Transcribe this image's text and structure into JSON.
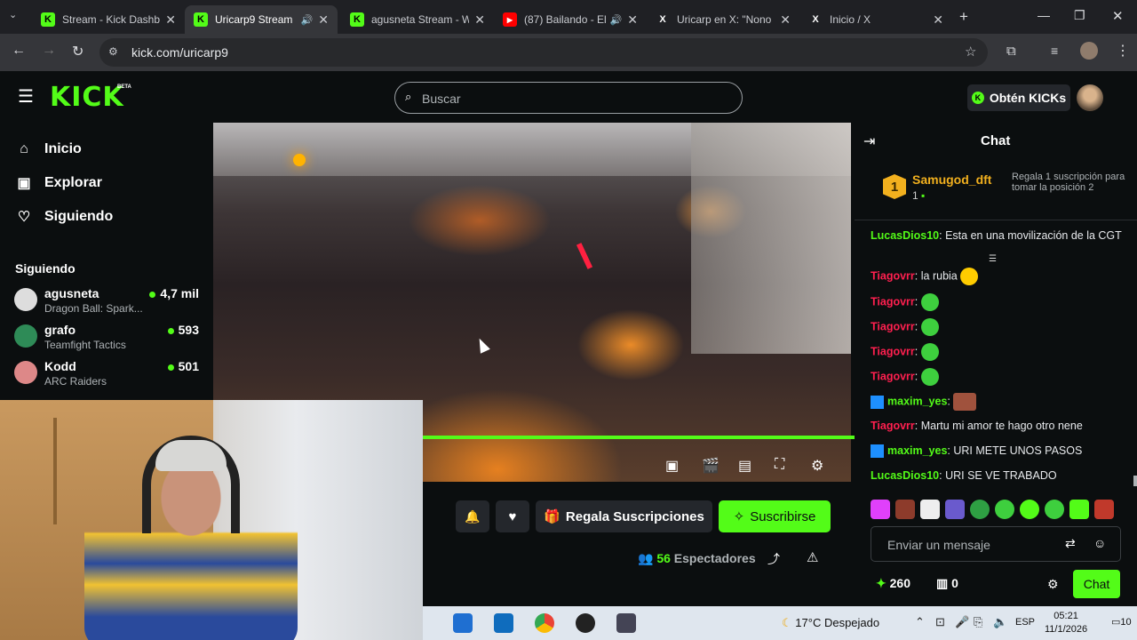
{
  "browser": {
    "tabs": [
      {
        "title": "Stream - Kick Dashbo",
        "favicon": "K"
      },
      {
        "title": "Uricarp9 Stream",
        "favicon": "K"
      },
      {
        "title": "agusneta Stream - W",
        "favicon": "K"
      },
      {
        "title": "(87) Bailando - El",
        "favicon": "YT"
      },
      {
        "title": "Uricarp en X: \"Nono l",
        "favicon": "X"
      },
      {
        "title": "Inicio / X",
        "favicon": "X"
      }
    ],
    "url": "kick.com/uricarp9"
  },
  "header": {
    "logo": "KICK",
    "logo_badge": "BETA",
    "search_placeholder": "Buscar",
    "get_kicks_label": "Obtén KICKs"
  },
  "sidebar": {
    "nav": [
      {
        "label": "Inicio",
        "icon": "home-icon"
      },
      {
        "label": "Explorar",
        "icon": "explore-icon"
      },
      {
        "label": "Siguiendo",
        "icon": "heart-icon"
      }
    ],
    "following_title": "Siguiendo",
    "channels": [
      {
        "name": "agusneta",
        "game": "Dragon Ball: Spark...",
        "viewers": "4,7 mil"
      },
      {
        "name": "grafo",
        "game": "Teamfight Tactics",
        "viewers": "593"
      },
      {
        "name": "Kodd",
        "game": "ARC Raiders",
        "viewers": "501"
      }
    ]
  },
  "player": {
    "progress": 1.0
  },
  "actions": {
    "gift_label": "Regala Suscripciones",
    "subscribe_label": "Suscribirse",
    "viewer_count": "56",
    "viewer_label": "Espectadores"
  },
  "chat": {
    "title": "Chat",
    "pinned": {
      "rank": "1",
      "user": "Samugod_dft",
      "count": "1",
      "description": "Regala 1 suscripción para tomar la posición 2"
    },
    "messages": [
      {
        "user": "LucasDios10",
        "color": "#53fc18",
        "text": "Esta en una movilización de la CGT",
        "emote": false
      },
      {
        "user": "Tiagovrr",
        "color": "#ff1f4f",
        "text": "la rubia",
        "emote": true
      },
      {
        "user": "Tiagovrr",
        "color": "#ff1f4f",
        "text": "",
        "emote": true
      },
      {
        "user": "Tiagovrr",
        "color": "#ff1f4f",
        "text": "",
        "emote": true
      },
      {
        "user": "Tiagovrr",
        "color": "#ff1f4f",
        "text": "",
        "emote": true
      },
      {
        "user": "Tiagovrr",
        "color": "#ff1f4f",
        "text": "",
        "emote": true
      },
      {
        "user": "maxim_yes",
        "color": "#53fc18",
        "text": "",
        "emote": true
      },
      {
        "user": "Tiagovrr",
        "color": "#ff1f4f",
        "text": "Martu mi amor te hago otro nene",
        "emote": false
      },
      {
        "user": "maxim_yes",
        "color": "#53fc18",
        "text": "URI METE UNOS PASOS",
        "emote": false
      },
      {
        "user": "LucasDios10",
        "color": "#53fc18",
        "text": "URI SE VE TRABADO",
        "emote": false
      }
    ],
    "input_placeholder": "Enviar un mensaje",
    "kicks_count": "260",
    "box_count": "0",
    "send_label": "Chat"
  },
  "taskbar": {
    "weather_temp": "17°C",
    "weather_desc": "Despejado",
    "lang": "ESP",
    "time": "05:21",
    "date": "11/1/2026",
    "notifications": "10"
  },
  "colors": {
    "accent": "#53fc18",
    "bg": "#0b0e0f",
    "panel": "#24272c"
  }
}
